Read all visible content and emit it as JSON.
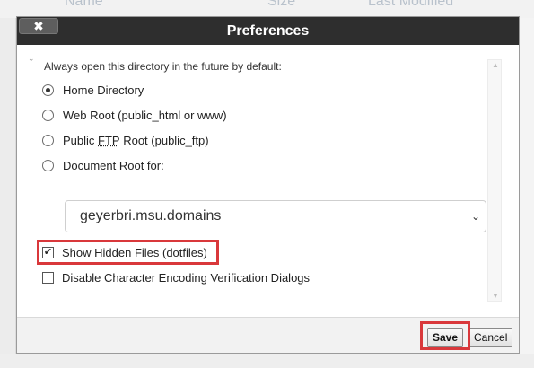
{
  "background": {
    "columns": [
      "Name",
      "Size",
      "Last Modified"
    ]
  },
  "dialog": {
    "title": "Preferences",
    "close_label": "✖",
    "prompt": "Always open this directory in the future by default:",
    "options": [
      {
        "label": "Home Directory",
        "checked": true
      },
      {
        "label_pre": "Web Root (public_html or www)",
        "checked": false
      },
      {
        "label_pre": "Public ",
        "label_u": "FTP",
        "label_post": " Root (public_ftp)",
        "checked": false
      },
      {
        "label": "Document Root for:",
        "checked": false
      }
    ],
    "domain_select": {
      "value": "geyerbri.msu.domains"
    },
    "checkboxes": [
      {
        "label": "Show Hidden Files (dotfiles)",
        "checked": true,
        "highlighted": true
      },
      {
        "label": "Disable Character Encoding Verification Dialogs",
        "checked": false,
        "highlighted": false
      }
    ],
    "buttons": {
      "save": "Save",
      "cancel": "Cancel"
    }
  },
  "colors": {
    "titlebar": "#2e2e2e",
    "highlight": "#d9383b"
  }
}
